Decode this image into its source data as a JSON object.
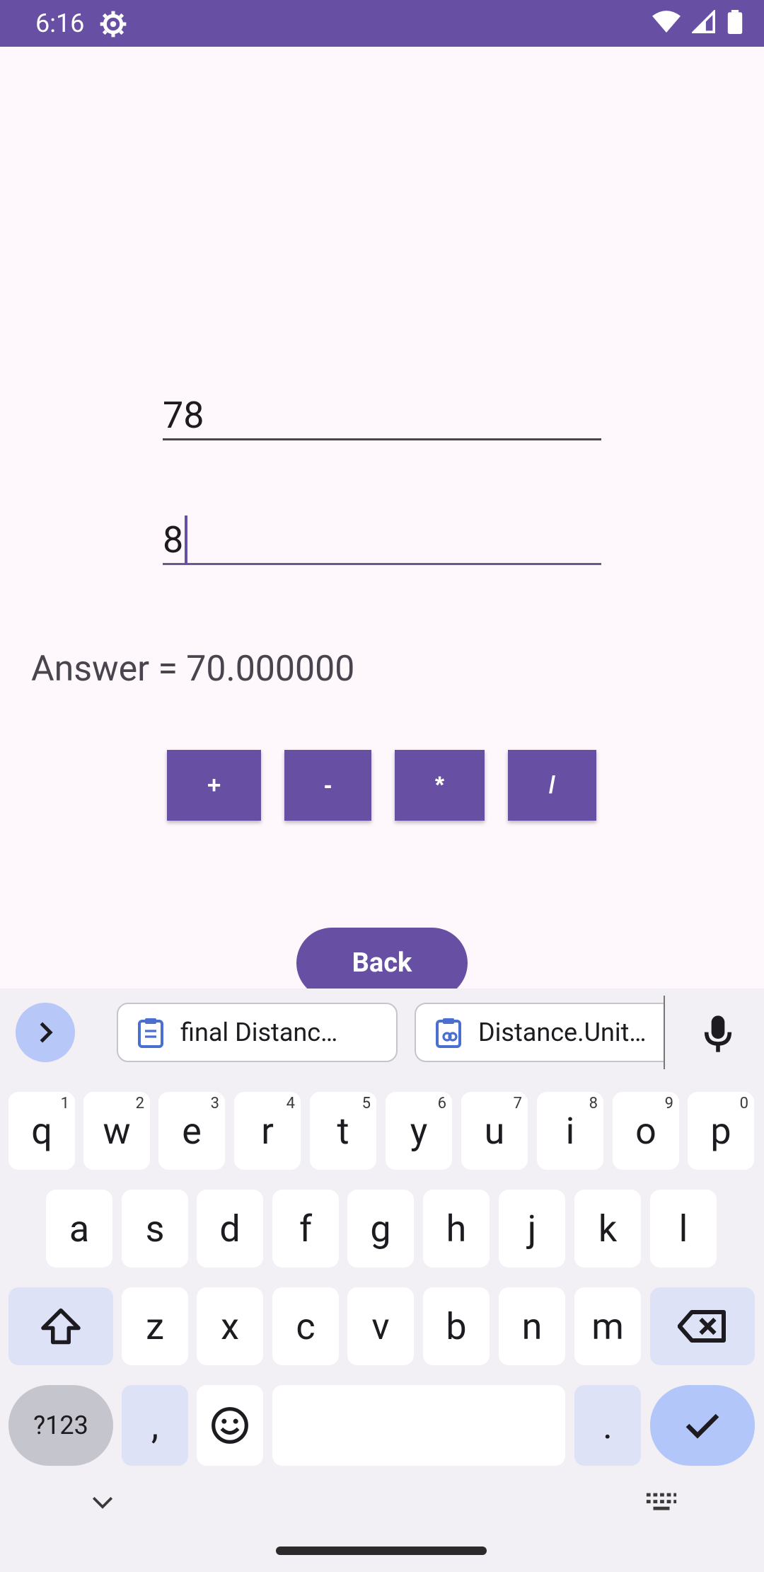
{
  "status": {
    "time": "6:16"
  },
  "inputs": [
    {
      "value": "78"
    },
    {
      "value": "8"
    }
  ],
  "answer": "Answer = 70.000000",
  "ops": [
    "+",
    "-",
    "*",
    "/"
  ],
  "back_label": "Back",
  "suggestions": [
    "final Distanc…",
    "Distance.Unit…"
  ],
  "keyboard": {
    "row1": [
      [
        "q",
        "1"
      ],
      [
        "w",
        "2"
      ],
      [
        "e",
        "3"
      ],
      [
        "r",
        "4"
      ],
      [
        "t",
        "5"
      ],
      [
        "y",
        "6"
      ],
      [
        "u",
        "7"
      ],
      [
        "i",
        "8"
      ],
      [
        "o",
        "9"
      ],
      [
        "p",
        "0"
      ]
    ],
    "row2": [
      "a",
      "s",
      "d",
      "f",
      "g",
      "h",
      "j",
      "k",
      "l"
    ],
    "row3": [
      "z",
      "x",
      "c",
      "v",
      "b",
      "n",
      "m"
    ],
    "symbols_label": "?123",
    "comma": ",",
    "period": "."
  },
  "colors": {
    "primary": "#6750a4",
    "accent_key": "#b3c6f9"
  }
}
